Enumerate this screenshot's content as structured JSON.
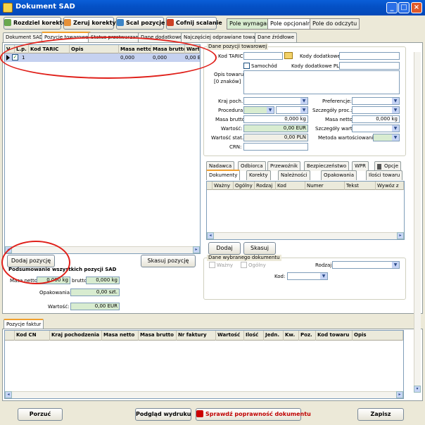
{
  "window": {
    "title": "Dokument SAD"
  },
  "toolbar": {
    "rozdziel": "Rozdziel korektę",
    "zeruj": "Zeruj korekty",
    "scal": "Scal pozycje",
    "cofnij": "Cofnij scalanie",
    "pole_wymagane": "Pole wymagane",
    "pole_opcjonalne": "Pole opcjonalne",
    "pole_odczytu": "Pole do odczytu"
  },
  "main_tabs": [
    "Dokument SAD",
    "Pozycje towarowe",
    "Status przetwarzania",
    "Dane dodatkowe",
    "Najczęściej odprawiane towary",
    "Dane źródłowe"
  ],
  "positions_grid": {
    "headers": [
      "V",
      "L.p.",
      "Kod TARIC",
      "Opis",
      "Masa netto",
      "Masa brutto",
      "Wartość"
    ],
    "row": {
      "lp": "1",
      "taric": "",
      "opis": "",
      "masa_netto": "0,000",
      "masa_brutto": "0,000",
      "wartosc": "0,00 EUR"
    }
  },
  "buttons": {
    "dodaj_pozycje": "Dodaj pozycję",
    "skasuj_pozycje": "Skasuj pozycję",
    "dodaj": "Dodaj",
    "skasuj": "Skasuj",
    "porzuc": "Porzuć",
    "podglad": "Podgląd wydruku",
    "sprawdz": "Sprawdź poprawność dokumentu",
    "zapisz": "Zapisz"
  },
  "summary": {
    "title": "Podsumowanie wszystkich pozycji SAD",
    "masa_netto_label": "Masa netto:",
    "masa_netto": "0,000 kg",
    "brutto_label": "brutto:",
    "masa_brutto": "0,000 kg",
    "opakowania_label": "Opakowania:",
    "opakowania": "0,00 szt.",
    "wartosc_label": "Wartość:",
    "wartosc": "0,00 EUR"
  },
  "details": {
    "title": "Dane pozycji towarowej",
    "kod_taric": "Kod TARIC:",
    "kody_dodatkowe": "Kody dodatkowe:",
    "samochod": "Samochód",
    "kody_dodatkowe_pl": "Kody dodatkowe PL:",
    "opis_towaru": "Opis towaru:",
    "znakow": "[0 znaków]",
    "kraj_poch": "Kraj poch.:",
    "preferencje": "Preferencje:",
    "procedura": "Procedura:",
    "szczegoly_proc": "Szczegóły proc.:",
    "masa_brutto": "Masa brutto:",
    "masa_brutto_val": "0,000 kg",
    "masa_netto": "Masa netto:",
    "masa_netto_val": "0,000 kg",
    "wartosc": "Wartość:",
    "wartosc_val": "0,00 EUR",
    "szczegoly_wart": "Szczegóły wart.:",
    "wartosc_stat": "Wartość stat.:",
    "wartosc_stat_val": "0,00 PLN",
    "metoda": "Metoda wartościowania:",
    "crn": "CRN:"
  },
  "sub_tabs_row1": [
    "Nadawca",
    "Odbiorca",
    "Przewoźnik",
    "Bezpieczeństwo",
    "WPR",
    "Opcje"
  ],
  "sub_tabs_row2": [
    "Dokumenty",
    "Korekty",
    "Należności",
    "Opakowania",
    "Ilości towaru"
  ],
  "documents_grid": {
    "headers": [
      "Ważny",
      "Ogólny",
      "Rodzaj",
      "Kod",
      "Numer",
      "Tekst",
      "Wywóz z"
    ]
  },
  "selected_doc": {
    "title": "Dane wybranego dokumentu",
    "wazny": "Ważny",
    "ogolny": "Ogólny",
    "rodzaj": "Rodzaj:",
    "kod": "Kod:"
  },
  "invoice_tab": "Pozycje faktur",
  "invoice_grid": {
    "headers": [
      "Kod CN",
      "Kraj pochodzenia",
      "Masa netto",
      "Masa brutto",
      "Nr faktury",
      "Wartość",
      "Ilość",
      "Jedn.",
      "Kw.",
      "Poz.",
      "Kod towaru",
      "Opis"
    ]
  },
  "colors": {
    "required": "#d8ecd0",
    "accent": "#0451c6",
    "annotation": "#e0201a"
  }
}
